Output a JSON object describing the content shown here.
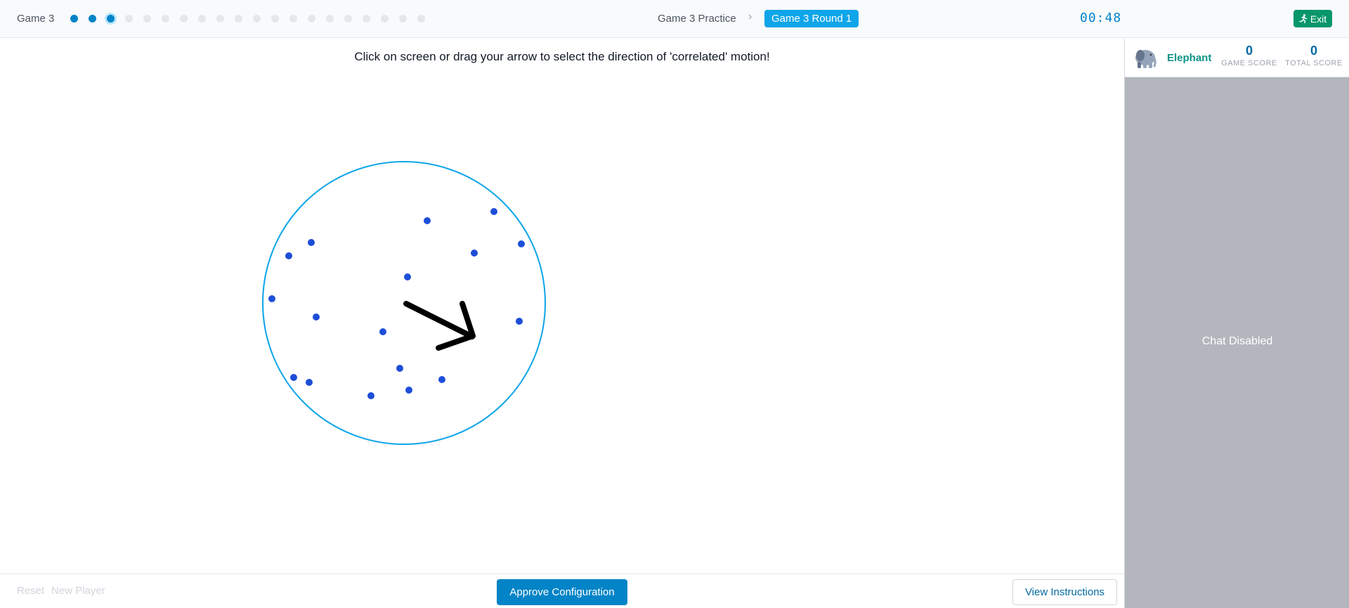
{
  "header": {
    "game_label": "Game 3",
    "progress": {
      "total": 20,
      "completed": 2,
      "current_index": 2
    },
    "breadcrumb": {
      "parent": "Game 3 Practice",
      "separator": "›",
      "current": "Game 3 Round 1"
    },
    "timer": "00:48",
    "exit_label": "Exit"
  },
  "main": {
    "instructions": "Click on screen or drag your arrow to select the direction of 'correlated' motion!",
    "field": {
      "circle_color": "#0ea5e9",
      "dot_color": "#1d4ed8",
      "arrow_color": "#000000",
      "dots": [
        [
          608,
          314
        ],
        [
          703,
          301
        ],
        [
          675,
          360
        ],
        [
          742,
          347
        ],
        [
          443,
          345
        ],
        [
          411,
          364
        ],
        [
          580,
          394
        ],
        [
          387,
          425
        ],
        [
          450,
          451
        ],
        [
          545,
          472
        ],
        [
          739,
          457
        ],
        [
          569,
          524
        ],
        [
          629,
          540
        ],
        [
          418,
          537
        ],
        [
          440,
          544
        ],
        [
          582,
          555
        ],
        [
          528,
          563
        ]
      ]
    }
  },
  "footer": {
    "reset_label": "Reset",
    "new_player_label": "New Player",
    "approve_label": "Approve Configuration",
    "view_instructions_label": "View Instructions"
  },
  "sidebar": {
    "player": {
      "name": "Elephant",
      "avatar_icon": "elephant-icon"
    },
    "game_score": {
      "value": "0",
      "label": "GAME SCORE"
    },
    "total_score": {
      "value": "0",
      "label": "TOTAL SCORE"
    },
    "chat_status": "Chat Disabled"
  }
}
